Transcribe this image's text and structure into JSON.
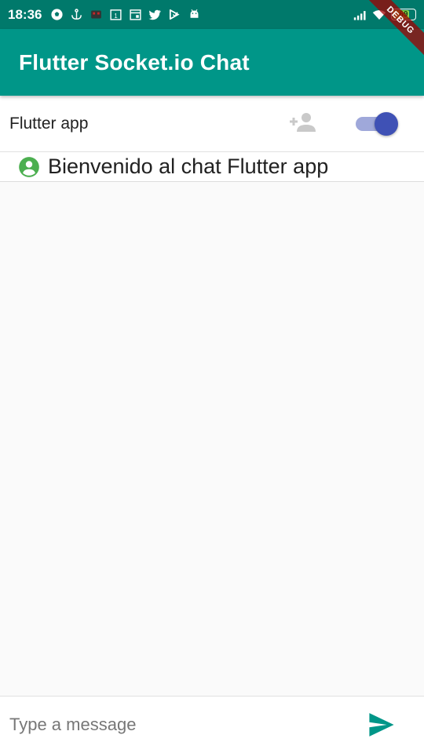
{
  "status_bar": {
    "time": "18:36",
    "left_icons": [
      "soccer-ball-icon",
      "anchor-icon",
      "game-icon",
      "calendar-icon",
      "calendar-grid-icon",
      "twitter-icon",
      "check-flag-icon",
      "android-icon"
    ],
    "right_icons": [
      "signal-icon",
      "wifi-icon"
    ],
    "battery_level": "69",
    "battery_color": "#8bd64a"
  },
  "debug_banner": "DEBUG",
  "app_bar": {
    "title": "Flutter Socket.io Chat",
    "color": "#009688"
  },
  "user_row": {
    "name": "Flutter app",
    "add_user_icon": "person-add-icon",
    "switch_on": true,
    "switch_color": "#3f51b5"
  },
  "messages": [
    {
      "icon": "account-circle-icon",
      "icon_color": "#4caf50",
      "text": "Bienvenido al chat Flutter app"
    }
  ],
  "input": {
    "placeholder": "Type a message",
    "value": "",
    "send_icon": "send-icon",
    "send_color": "#009688"
  }
}
